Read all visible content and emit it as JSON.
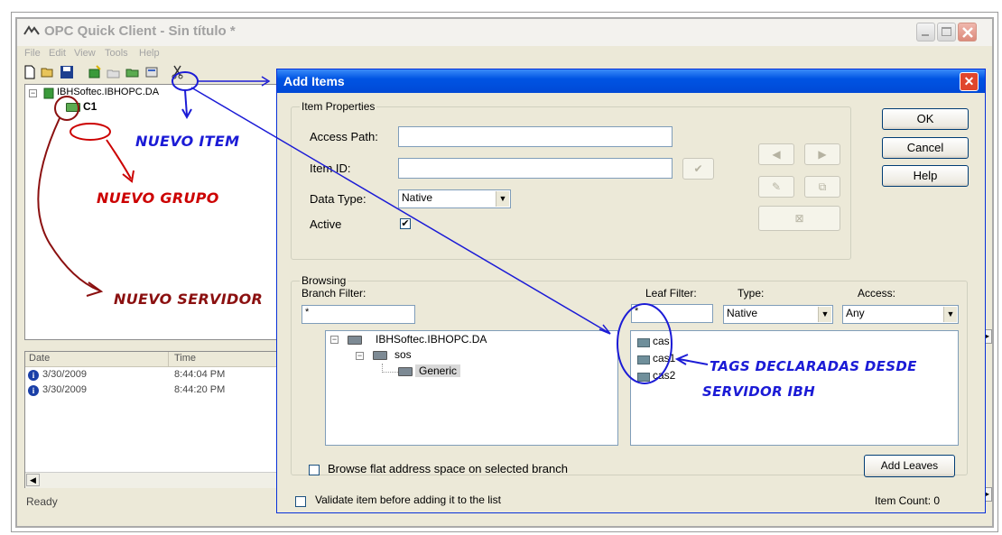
{
  "main_window": {
    "title": "OPC Quick Client - Sin título *",
    "menu": [
      "File",
      "Edit",
      "View",
      "Tools",
      "Help"
    ],
    "tree": {
      "server": "IBHSoftec.IBHOPC.DA",
      "group": "C1"
    },
    "log": {
      "columns": [
        "Date",
        "Time"
      ],
      "rows": [
        {
          "date": "3/30/2009",
          "time": "8:44:04 PM"
        },
        {
          "date": "3/30/2009",
          "time": "8:44:20 PM"
        }
      ]
    },
    "status": "Ready"
  },
  "dialog": {
    "title": "Add Items",
    "item_properties": {
      "label": "Item Properties",
      "access_path_label": "Access Path:",
      "access_path_value": "",
      "item_id_label": "Item ID:",
      "item_id_value": "",
      "data_type_label": "Data Type:",
      "data_type_value": "Native",
      "active_label": "Active",
      "active_checked": true
    },
    "buttons": {
      "ok": "OK",
      "cancel": "Cancel",
      "help": "Help",
      "add_leaves": "Add Leaves"
    },
    "browsing": {
      "label": "Browsing",
      "branch_filter_label": "Branch Filter:",
      "branch_filter_value": "*",
      "leaf_filter_label": "Leaf Filter:",
      "leaf_filter_value": "*",
      "type_label": "Type:",
      "type_value": "Native",
      "access_label": "Access:",
      "access_value": "Any",
      "branches": {
        "root": "IBHSoftec.IBHOPC.DA",
        "child": "sos",
        "leaf": "Generic"
      },
      "leaves": [
        "cas",
        "cas1",
        "cas2"
      ],
      "flat_label": "Browse flat address space on selected branch"
    },
    "validate_label": "Validate item before adding it to the list",
    "item_count": "Item Count: 0"
  },
  "annotations": {
    "nuevo_item": "NUEVO ITEM",
    "nuevo_grupo": "NUEVO GRUPO",
    "nuevo_servidor": "NUEVO SERVIDOR",
    "tags_line1": "TAGS DECLARADAS DESDE",
    "tags_line2": "SERVIDOR IBH"
  },
  "colors": {
    "annotation_blue": "#1b1bd6",
    "annotation_red": "#cc0000",
    "annotation_darkred": "#8b1010",
    "xp_title": "#0054e3"
  }
}
